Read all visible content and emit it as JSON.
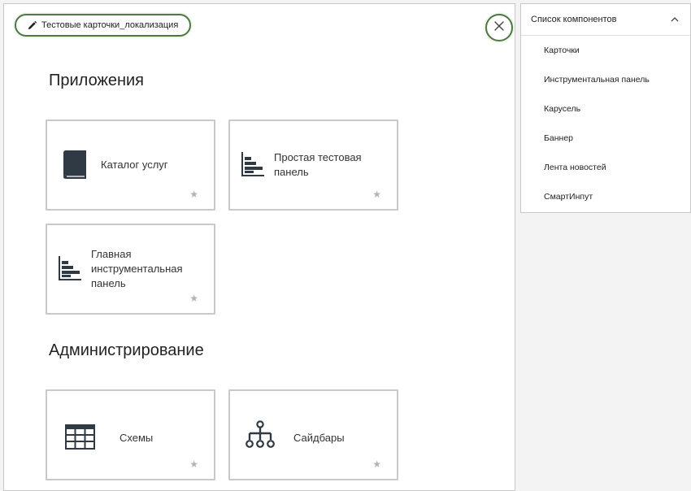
{
  "editor": {
    "title": "Тестовые карточки_локализация",
    "edit_icon": "pencil-icon",
    "close_icon": "close-icon"
  },
  "sections": [
    {
      "title": "Приложения",
      "cards": [
        {
          "label": "Каталог услуг",
          "icon": "book-icon"
        },
        {
          "label": "Простая тестовая панель",
          "icon": "bar-chart-icon"
        },
        {
          "label": "Главная инструментальная панель",
          "icon": "bar-chart-icon"
        }
      ]
    },
    {
      "title": "Администрирование",
      "cards": [
        {
          "label": "Схемы",
          "icon": "table-icon"
        },
        {
          "label": "Сайдбары",
          "icon": "hierarchy-icon"
        }
      ]
    }
  ],
  "favorite_icon": "★",
  "components_panel": {
    "title": "Список компонентов",
    "toggle_icon": "chevron-up-icon",
    "items": [
      "Карточки",
      "Инструментальная панель",
      "Карусель",
      "Баннер",
      "Лента новостей",
      "СмартИнпут"
    ]
  },
  "colors": {
    "accent": "#4d7a3f",
    "icon": "#2f3a45",
    "border": "#c9c9c9"
  }
}
